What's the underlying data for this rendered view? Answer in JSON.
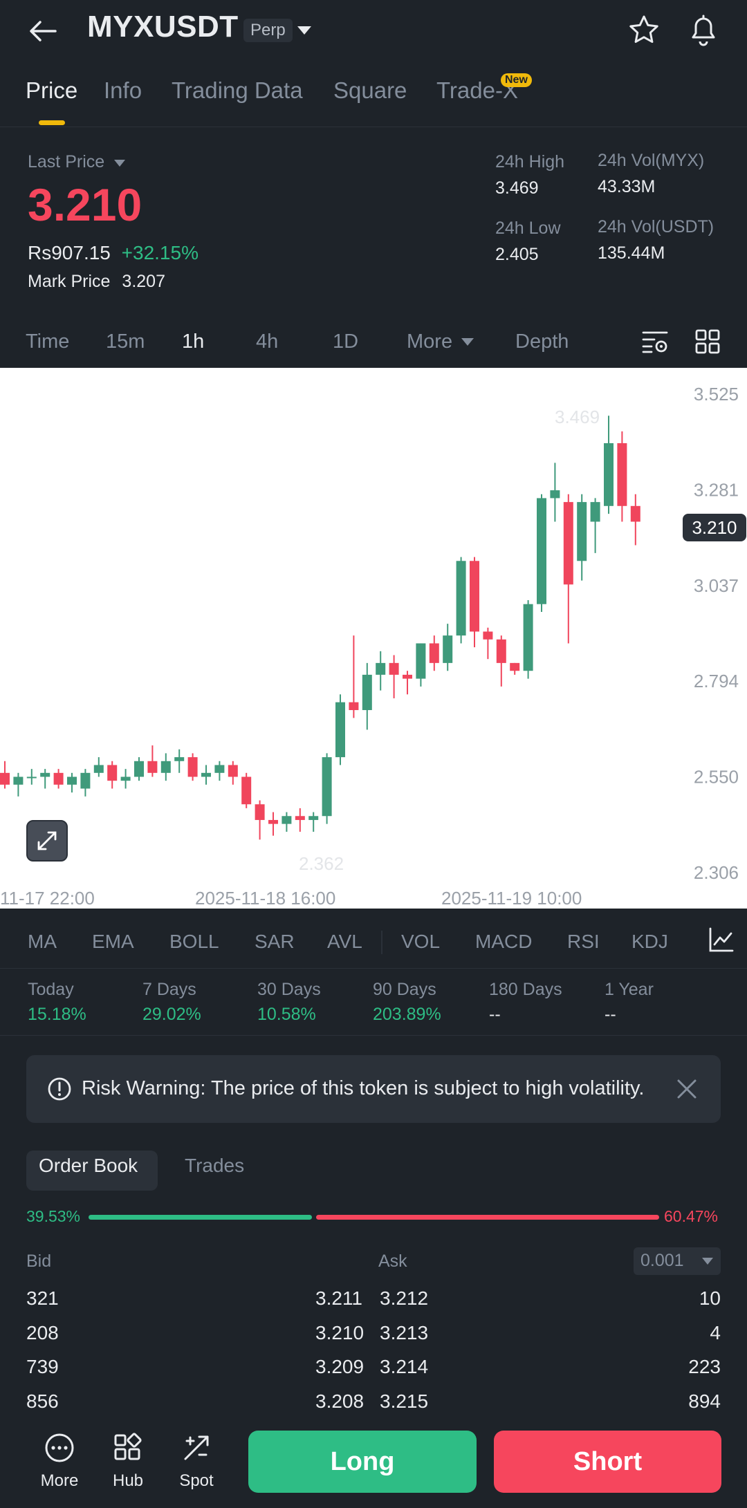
{
  "header": {
    "symbol": "MYXUSDT",
    "badge": "Perp",
    "icons": [
      "back-arrow-icon",
      "dropdown-caret-icon",
      "star-icon",
      "bell-icon"
    ]
  },
  "tabs": [
    {
      "label": "Price",
      "active": true
    },
    {
      "label": "Info"
    },
    {
      "label": "Trading Data"
    },
    {
      "label": "Square"
    },
    {
      "label": "Trade-X",
      "badge": "New"
    }
  ],
  "price": {
    "last_price_label": "Last Price",
    "last_price": "3.210",
    "fiat_value": "Rs907.15",
    "change_pct": "+32.15%",
    "mark_price_label": "Mark Price",
    "mark_price": "3.207",
    "high_label": "24h High",
    "high": "3.469",
    "low_label": "24h Low",
    "low": "2.405",
    "vol_base_label": "24h Vol(MYX)",
    "vol_base": "43.33M",
    "vol_quote_label": "24h Vol(USDT)",
    "vol_quote": "135.44M"
  },
  "intervals": [
    {
      "label": "Time"
    },
    {
      "label": "15m"
    },
    {
      "label": "1h",
      "active": true
    },
    {
      "label": "4h"
    },
    {
      "label": "1D"
    },
    {
      "label": "More"
    },
    {
      "label": "Depth"
    }
  ],
  "chart_data": {
    "type": "candlestick",
    "y_ticks": [
      "3.525",
      "3.281",
      "3.037",
      "2.794",
      "2.550",
      "2.306"
    ],
    "ylim": [
      2.306,
      3.525
    ],
    "current_price_tag": "3.210",
    "max_label": "3.469",
    "min_label": "2.362",
    "x_ticks": [
      "11-17 22:00",
      "2025-11-18 16:00",
      "2025-11-19 10:00"
    ],
    "candles": [
      [
        2.56,
        2.53,
        2.59,
        2.52
      ],
      [
        2.53,
        2.55,
        2.56,
        2.5
      ],
      [
        2.55,
        2.55,
        2.57,
        2.53
      ],
      [
        2.55,
        2.56,
        2.57,
        2.52
      ],
      [
        2.56,
        2.53,
        2.57,
        2.52
      ],
      [
        2.53,
        2.55,
        2.56,
        2.51
      ],
      [
        2.52,
        2.56,
        2.57,
        2.5
      ],
      [
        2.56,
        2.58,
        2.6,
        2.55
      ],
      [
        2.58,
        2.54,
        2.59,
        2.52
      ],
      [
        2.54,
        2.55,
        2.57,
        2.52
      ],
      [
        2.55,
        2.59,
        2.6,
        2.54
      ],
      [
        2.59,
        2.56,
        2.63,
        2.55
      ],
      [
        2.56,
        2.59,
        2.61,
        2.54
      ],
      [
        2.59,
        2.6,
        2.62,
        2.56
      ],
      [
        2.6,
        2.55,
        2.61,
        2.54
      ],
      [
        2.55,
        2.56,
        2.58,
        2.53
      ],
      [
        2.56,
        2.58,
        2.59,
        2.54
      ],
      [
        2.58,
        2.55,
        2.59,
        2.53
      ],
      [
        2.55,
        2.48,
        2.56,
        2.47
      ],
      [
        2.48,
        2.44,
        2.49,
        2.39
      ],
      [
        2.44,
        2.43,
        2.46,
        2.4
      ],
      [
        2.43,
        2.45,
        2.46,
        2.41
      ],
      [
        2.45,
        2.44,
        2.47,
        2.41
      ],
      [
        2.44,
        2.45,
        2.46,
        2.41
      ],
      [
        2.45,
        2.6,
        2.61,
        2.43
      ],
      [
        2.6,
        2.74,
        2.76,
        2.58
      ],
      [
        2.74,
        2.72,
        2.91,
        2.7
      ],
      [
        2.72,
        2.81,
        2.84,
        2.67
      ],
      [
        2.81,
        2.84,
        2.87,
        2.77
      ],
      [
        2.84,
        2.81,
        2.86,
        2.75
      ],
      [
        2.81,
        2.8,
        2.82,
        2.76
      ],
      [
        2.8,
        2.89,
        2.89,
        2.78
      ],
      [
        2.89,
        2.84,
        2.91,
        2.82
      ],
      [
        2.84,
        2.91,
        2.94,
        2.82
      ],
      [
        2.91,
        3.1,
        3.11,
        2.89
      ],
      [
        3.1,
        2.92,
        3.11,
        2.88
      ],
      [
        2.92,
        2.9,
        2.93,
        2.85
      ],
      [
        2.9,
        2.84,
        2.91,
        2.78
      ],
      [
        2.84,
        2.82,
        2.84,
        2.81
      ],
      [
        2.82,
        2.99,
        3.0,
        2.8
      ],
      [
        2.99,
        3.26,
        3.27,
        2.97
      ],
      [
        3.26,
        3.28,
        3.35,
        3.2
      ],
      [
        3.25,
        3.04,
        3.27,
        2.89
      ],
      [
        3.1,
        3.25,
        3.27,
        3.05
      ],
      [
        3.2,
        3.25,
        3.26,
        3.12
      ],
      [
        3.24,
        3.4,
        3.47,
        3.22
      ],
      [
        3.4,
        3.24,
        3.43,
        3.2
      ],
      [
        3.24,
        3.2,
        3.27,
        3.14
      ]
    ],
    "grid": false
  },
  "indicators": [
    "MA",
    "EMA",
    "BOLL",
    "SAR",
    "AVL",
    "VOL",
    "MACD",
    "RSI",
    "KDJ"
  ],
  "performance": [
    {
      "label": "Today",
      "value": "15.18%"
    },
    {
      "label": "7 Days",
      "value": "29.02%"
    },
    {
      "label": "30 Days",
      "value": "10.58%"
    },
    {
      "label": "90 Days",
      "value": "203.89%"
    },
    {
      "label": "180 Days",
      "value": "--"
    },
    {
      "label": "1 Year",
      "value": "--"
    }
  ],
  "risk_warning": "Risk Warning: The price of this token is subject to high volatility.",
  "orderbook": {
    "tab_active": "Order Book",
    "tab_other": "Trades",
    "bid_pct": "39.53%",
    "ask_pct": "60.47%",
    "bid_ratio": 0.3953,
    "bid_label": "Bid",
    "ask_label": "Ask",
    "precision": "0.001",
    "rows": [
      {
        "bid_qty": "321",
        "bid_price": "3.211",
        "ask_price": "3.212",
        "ask_qty": "10"
      },
      {
        "bid_qty": "208",
        "bid_price": "3.210",
        "ask_price": "3.213",
        "ask_qty": "4"
      },
      {
        "bid_qty": "739",
        "bid_price": "3.209",
        "ask_price": "3.214",
        "ask_qty": "223"
      },
      {
        "bid_qty": "856",
        "bid_price": "3.208",
        "ask_price": "3.215",
        "ask_qty": "894"
      }
    ]
  },
  "bottom_nav": {
    "more": "More",
    "hub": "Hub",
    "spot": "Spot",
    "long": "Long",
    "short": "Short"
  },
  "colors": {
    "up": "#2ebd85",
    "down": "#f6465d",
    "accent": "#f0b90b",
    "bg": "#1e2329"
  }
}
